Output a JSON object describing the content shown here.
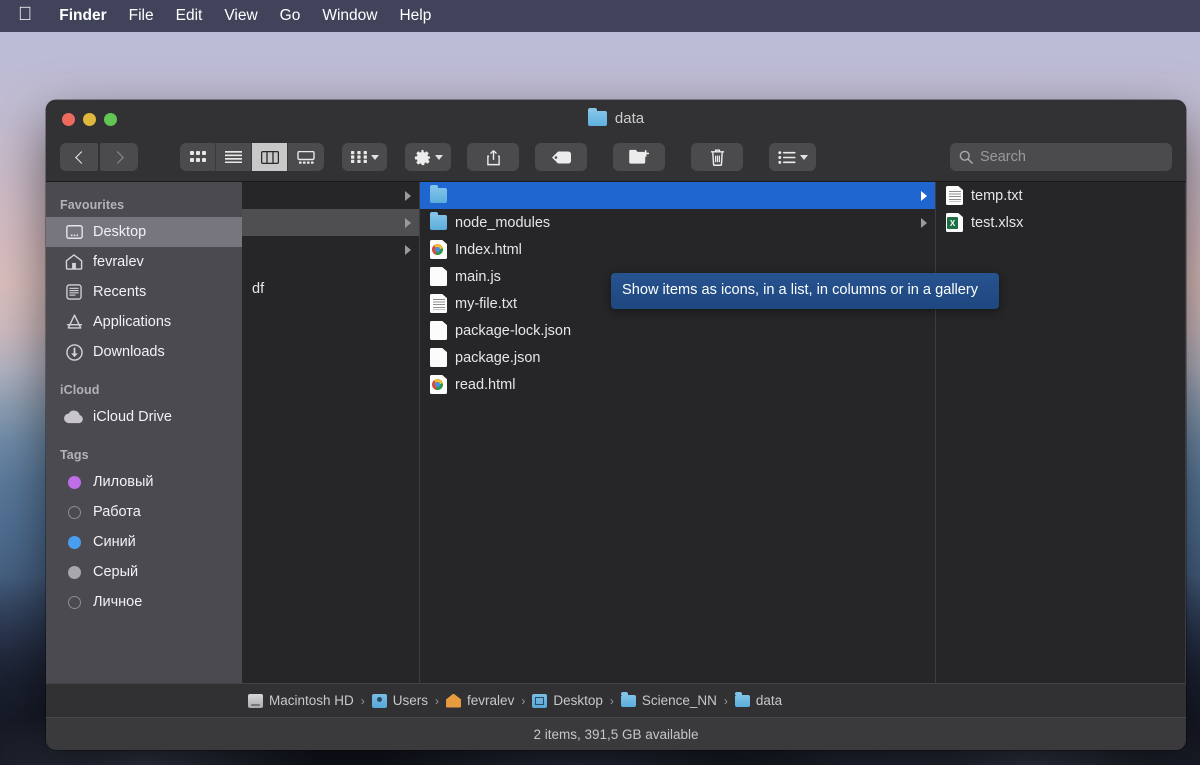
{
  "menubar": {
    "apple": "apple-logo",
    "items": [
      {
        "label": "Finder",
        "bold": true
      },
      {
        "label": "File",
        "bold": false
      },
      {
        "label": "Edit",
        "bold": false
      },
      {
        "label": "View",
        "bold": false
      },
      {
        "label": "Go",
        "bold": false
      },
      {
        "label": "Window",
        "bold": false
      },
      {
        "label": "Help",
        "bold": false
      }
    ]
  },
  "window": {
    "title": "data",
    "traffic_lights": [
      "close",
      "minimize",
      "zoom"
    ]
  },
  "toolbar": {
    "back": "back-arrow",
    "forward": "forward-arrow",
    "view_modes": [
      {
        "name": "icon-view",
        "active": false
      },
      {
        "name": "list-view",
        "active": false
      },
      {
        "name": "column-view",
        "active": true
      },
      {
        "name": "gallery-view",
        "active": false
      }
    ],
    "group_button": "group-items",
    "action_button": "action-gear",
    "share_button": "share",
    "tag_button": "edit-tags",
    "new_folder_button": "new-folder",
    "delete_button": "delete",
    "arrange_button": "arrange-list",
    "search_placeholder": "Search",
    "search_value": ""
  },
  "tooltip": {
    "text": "Show items as icons, in a list, in columns or in a gallery"
  },
  "sidebar": {
    "sections": [
      {
        "header": "Favourites",
        "items": [
          {
            "label": "Desktop",
            "icon": "desktop-icon",
            "selected": true
          },
          {
            "label": "fevralev",
            "icon": "home-icon",
            "selected": false
          },
          {
            "label": "Recents",
            "icon": "recents-icon",
            "selected": false
          },
          {
            "label": "Applications",
            "icon": "applications-icon",
            "selected": false
          },
          {
            "label": "Downloads",
            "icon": "downloads-icon",
            "selected": false
          }
        ]
      },
      {
        "header": "iCloud",
        "items": [
          {
            "label": "iCloud Drive",
            "icon": "cloud-icon",
            "selected": false
          }
        ]
      },
      {
        "header": "Tags",
        "items": [
          {
            "label": "Лиловый",
            "icon": "tag-dot",
            "color": "#c06ee8",
            "selected": false
          },
          {
            "label": "Работа",
            "icon": "tag-dot",
            "color": "",
            "selected": false
          },
          {
            "label": "Синий",
            "icon": "tag-dot",
            "color": "#4a9ef0",
            "selected": false
          },
          {
            "label": "Серый",
            "icon": "tag-dot",
            "color": "#a8a8ac",
            "selected": false
          },
          {
            "label": "Личное",
            "icon": "tag-dot",
            "color": "",
            "selected": false
          }
        ]
      }
    ]
  },
  "columns": {
    "col1": {
      "rows": [
        {
          "label": "",
          "icon": "",
          "arrow": true,
          "state": "none"
        },
        {
          "label": "",
          "icon": "",
          "arrow": true,
          "state": "grey"
        },
        {
          "label": "",
          "icon": "",
          "arrow": true,
          "state": "none"
        },
        {
          "label": "df",
          "icon": "",
          "arrow": false,
          "state": "none"
        }
      ]
    },
    "col2": {
      "rows": [
        {
          "label": "",
          "icon": "folder",
          "arrow": true,
          "state": "blue"
        },
        {
          "label": "node_modules",
          "icon": "folder",
          "arrow": true,
          "state": "none"
        },
        {
          "label": "Index.html",
          "icon": "chrome",
          "arrow": false,
          "state": "none"
        },
        {
          "label": "main.js",
          "icon": "doc",
          "arrow": false,
          "state": "none"
        },
        {
          "label": "my-file.txt",
          "icon": "txt",
          "arrow": false,
          "state": "none"
        },
        {
          "label": "package-lock.json",
          "icon": "doc",
          "arrow": false,
          "state": "none"
        },
        {
          "label": "package.json",
          "icon": "doc",
          "arrow": false,
          "state": "none"
        },
        {
          "label": "read.html",
          "icon": "chrome",
          "arrow": false,
          "state": "none"
        }
      ]
    },
    "col3": {
      "rows": [
        {
          "label": "temp.txt",
          "icon": "txt",
          "arrow": false,
          "state": "none"
        },
        {
          "label": "test.xlsx",
          "icon": "xls",
          "arrow": false,
          "state": "none"
        }
      ]
    }
  },
  "pathbar": {
    "items": [
      {
        "label": "Macintosh HD",
        "icon": "hd"
      },
      {
        "label": "Users",
        "icon": "users"
      },
      {
        "label": "fevralev",
        "icon": "home"
      },
      {
        "label": "Desktop",
        "icon": "desk"
      },
      {
        "label": "Science_NN",
        "icon": "folder"
      },
      {
        "label": "data",
        "icon": "folder"
      }
    ],
    "separator": "›"
  },
  "statusbar": {
    "text": "2 items, 391,5 GB available"
  }
}
